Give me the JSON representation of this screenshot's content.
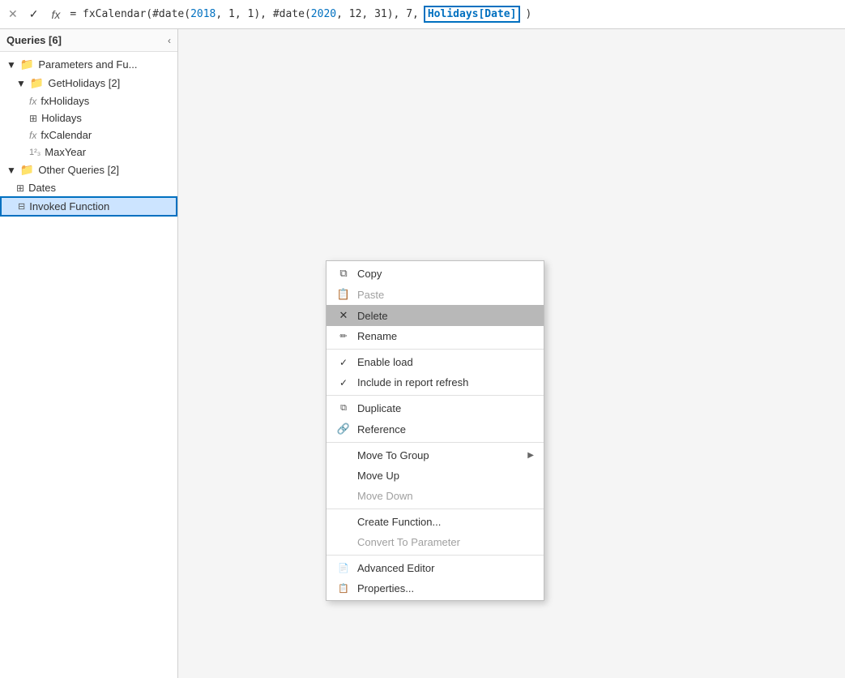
{
  "formulaBar": {
    "cancelLabel": "✕",
    "confirmLabel": "✓",
    "fxLabel": "fx",
    "formulaText": "= fxCalendar(#date(2018, 1, 1), #date(2020, 12, 31), 7, ",
    "formulaHighlight": "Holidays[Date]"
  },
  "sidebar": {
    "title": "Queries [6]",
    "collapseIcon": "‹",
    "groups": [
      {
        "name": "Parameters and Fu...",
        "type": "folder",
        "expanded": true,
        "children": [
          {
            "name": "GetHolidays [2]",
            "type": "folder",
            "expanded": true,
            "children": [
              {
                "name": "fxHolidays",
                "type": "fx"
              },
              {
                "name": "Holidays",
                "type": "table"
              },
              {
                "name": "fxCalendar",
                "type": "fx"
              },
              {
                "name": "MaxYear",
                "type": "param"
              }
            ]
          }
        ]
      },
      {
        "name": "Other Queries [2]",
        "type": "folder",
        "expanded": true,
        "children": [
          {
            "name": "Dates",
            "type": "table"
          },
          {
            "name": "Invoked Function",
            "type": "invoked",
            "selected": true
          }
        ]
      }
    ]
  },
  "contextMenu": {
    "items": [
      {
        "id": "copy",
        "label": "Copy",
        "icon": "copy",
        "disabled": false,
        "checked": false,
        "hasArrow": false
      },
      {
        "id": "paste",
        "label": "Paste",
        "icon": "paste",
        "disabled": true,
        "checked": false,
        "hasArrow": false
      },
      {
        "id": "delete",
        "label": "Delete",
        "icon": "x",
        "disabled": false,
        "checked": false,
        "hasArrow": false,
        "highlighted": true
      },
      {
        "id": "rename",
        "label": "Rename",
        "icon": "rename",
        "disabled": false,
        "checked": false,
        "hasArrow": false
      },
      {
        "id": "sep1",
        "type": "separator"
      },
      {
        "id": "enable-load",
        "label": "Enable load",
        "icon": "",
        "disabled": false,
        "checked": true,
        "hasArrow": false
      },
      {
        "id": "include-refresh",
        "label": "Include in report refresh",
        "icon": "",
        "disabled": false,
        "checked": true,
        "hasArrow": false
      },
      {
        "id": "sep2",
        "type": "separator"
      },
      {
        "id": "duplicate",
        "label": "Duplicate",
        "icon": "duplicate",
        "disabled": false,
        "checked": false,
        "hasArrow": false
      },
      {
        "id": "reference",
        "label": "Reference",
        "icon": "reference",
        "disabled": false,
        "checked": false,
        "hasArrow": false
      },
      {
        "id": "sep3",
        "type": "separator"
      },
      {
        "id": "move-to-group",
        "label": "Move To Group",
        "icon": "",
        "disabled": false,
        "checked": false,
        "hasArrow": true
      },
      {
        "id": "move-up",
        "label": "Move Up",
        "icon": "",
        "disabled": false,
        "checked": false,
        "hasArrow": false
      },
      {
        "id": "move-down",
        "label": "Move Down",
        "icon": "",
        "disabled": true,
        "checked": false,
        "hasArrow": false
      },
      {
        "id": "sep4",
        "type": "separator"
      },
      {
        "id": "create-function",
        "label": "Create Function...",
        "icon": "",
        "disabled": false,
        "checked": false,
        "hasArrow": false
      },
      {
        "id": "convert-param",
        "label": "Convert To Parameter",
        "icon": "",
        "disabled": true,
        "checked": false,
        "hasArrow": false
      },
      {
        "id": "sep5",
        "type": "separator"
      },
      {
        "id": "advanced-editor",
        "label": "Advanced Editor",
        "icon": "editor",
        "disabled": false,
        "checked": false,
        "hasArrow": false
      },
      {
        "id": "properties",
        "label": "Properties...",
        "icon": "props",
        "disabled": false,
        "checked": false,
        "hasArrow": false
      }
    ]
  }
}
